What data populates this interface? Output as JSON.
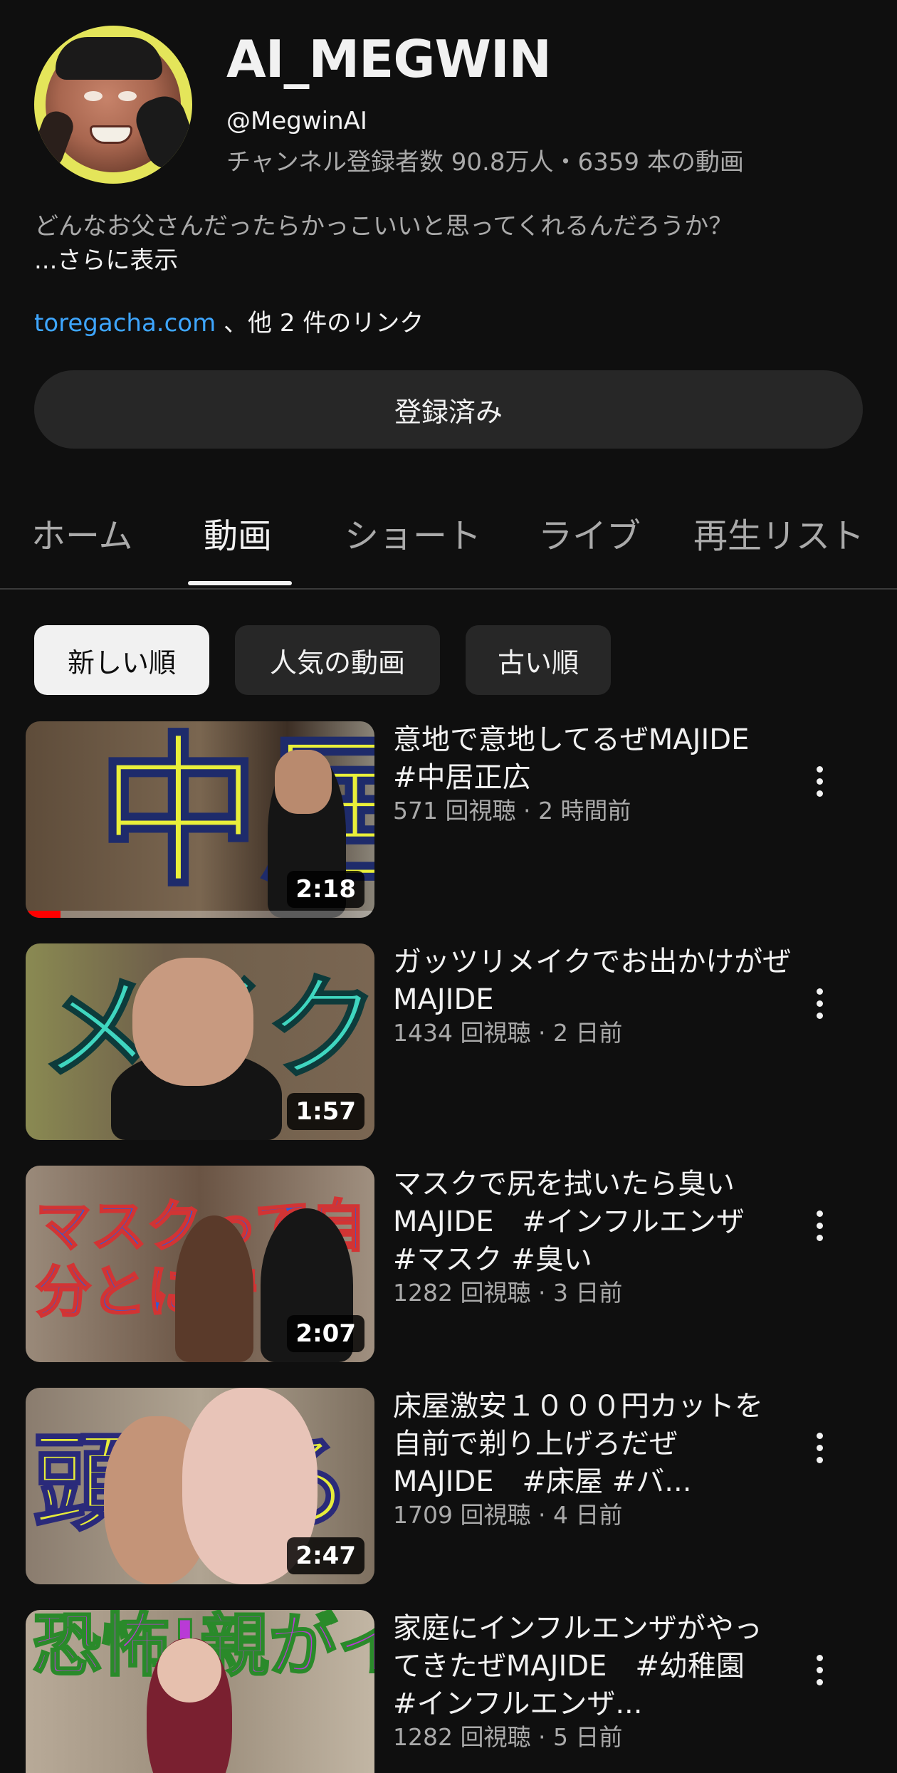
{
  "channel": {
    "name": "AI_MEGWIN",
    "handle": "@MegwinAI",
    "stats": "チャンネル登録者数 90.8万人・6359 本の動画",
    "description": "どんなお父さんだったらかっこいいと思ってくれるんだろうか？",
    "more_label": "...さらに表示",
    "link_text": "toregacha.com",
    "link_suffix": "、他 2 件のリンク",
    "subscribe_label": "登録済み"
  },
  "tabs": [
    {
      "label": "ホーム",
      "active": false
    },
    {
      "label": "動画",
      "active": true
    },
    {
      "label": "ショート",
      "active": false
    },
    {
      "label": "ライブ",
      "active": false
    },
    {
      "label": "再生リスト",
      "active": false
    }
  ],
  "sort_chips": [
    {
      "label": "新しい順",
      "selected": true
    },
    {
      "label": "人気の動画",
      "selected": false
    },
    {
      "label": "古い順",
      "selected": false
    }
  ],
  "videos": [
    {
      "title": "意地で意地してるぜMAJIDE　#中居正広",
      "meta": "571 回視聴 · 2 時間前",
      "duration": "2:18",
      "thumb_text": "中居",
      "thumb_colors": {
        "bg": "#6b5a48",
        "text": "#e9ef3a",
        "stroke": "#1e2b6b"
      },
      "watch_progress": 0.1,
      "menu_icon": "more-vert-icon"
    },
    {
      "title": "ガッツリメイクでお出かけがぜMAJIDE",
      "meta": "1434 回視聴 · 2 日前",
      "duration": "1:57",
      "thumb_text": "メイク",
      "thumb_colors": {
        "bg": "#7a6a58",
        "text": "#3fd6c0",
        "stroke": "#0d3b3b"
      },
      "watch_progress": 0,
      "menu_icon": "more-vert-icon"
    },
    {
      "title": "マスクで尻を拭いたら臭いMAJIDE　#インフルエンザ #マスク #臭い",
      "meta": "1282 回視聴 · 3 日前",
      "duration": "2:07",
      "thumb_text": "マスクって自分とに守っ",
      "thumb_colors": {
        "bg": "#8a7868",
        "text": "#2f5cd6",
        "stroke": "#d23434"
      },
      "watch_progress": 0,
      "menu_icon": "more-vert-icon"
    },
    {
      "title": "床屋激安１０００円カットを自前で剃り上げろだぜMAJIDE　#床屋 #バ...",
      "meta": "1709 回視聴 · 4 日前",
      "duration": "2:47",
      "thumb_text": "頭ろ",
      "thumb_colors": {
        "bg": "#9a8c7e",
        "text": "#e6ec3a",
        "stroke": "#2a2a7a"
      },
      "watch_progress": 0,
      "menu_icon": "more-vert-icon"
    },
    {
      "title": "家庭にインフルエンザがやってきたぜMAJIDE　#幼稚園 #インフルエンザ...",
      "meta": "1282 回視聴 · 5 日前",
      "duration": "",
      "thumb_text": "恐怖!親がイ",
      "thumb_colors": {
        "bg": "#b8aa98",
        "text": "#b93ad6",
        "stroke": "#2a8a2a"
      },
      "watch_progress": 0,
      "menu_icon": "more-vert-icon"
    }
  ]
}
